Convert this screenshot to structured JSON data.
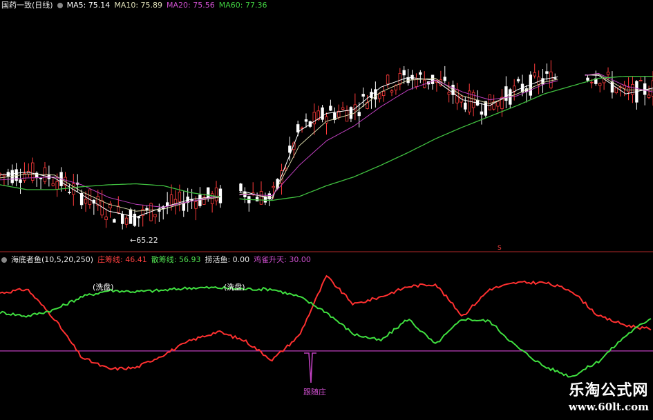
{
  "header": {
    "stock": "国药一致(日线)",
    "ma5": "MA5: 75.14",
    "ma10": "MA10: 75.89",
    "ma20": "MA20: 75.56",
    "ma60": "MA60: 77.36"
  },
  "indicator": {
    "name": "海底者鱼(10,5,20,250)",
    "zhuang": "庄筹线: 46.41",
    "san": "散筹线: 56.93",
    "laohuo": "捞活鱼: 0.00",
    "jique": "鸡雀升天: 30.00"
  },
  "annotations": {
    "low_price": "←65.22",
    "xipan1": "(洗盘)",
    "xipan2": "(洗盘)",
    "genzhuang": "跟随庄",
    "s_mark": "S"
  },
  "watermark": {
    "line1": "乐淘公式网",
    "line2": "www.60lt.com"
  },
  "colors": {
    "background": "#000000",
    "up": "#ff3b3b",
    "down": "#ffffff",
    "ma5": "#ffffff",
    "ma10": "#d8d8a8",
    "ma20": "#c040c0",
    "ma60": "#40c040",
    "zhuang": "#ff3030",
    "san": "#40e040",
    "level_line": "#c040c0"
  },
  "chart_data": [
    {
      "type": "line",
      "title": "国药一致(日线)",
      "description": "candlestick price chart with moving averages",
      "x": [
        0,
        5,
        10,
        15,
        20,
        25,
        30,
        35,
        40,
        45,
        50,
        55,
        60,
        65,
        70,
        75,
        80,
        85,
        90,
        95,
        100,
        105,
        110,
        115,
        120
      ],
      "series": [
        {
          "name": "MA5",
          "values": [
            70.5,
            70.8,
            70.2,
            68.5,
            66.8,
            66.2,
            67.2,
            68.0,
            68.3,
            68.8,
            68.0,
            75.0,
            76.8,
            77.2,
            79.5,
            80.5,
            80.2,
            78.2,
            77.6,
            79.2,
            80.3,
            80.8,
            80.7,
            78.8,
            79.4
          ]
        },
        {
          "name": "MA10",
          "values": [
            70.2,
            70.6,
            70.5,
            68.8,
            67.5,
            66.8,
            67.0,
            67.8,
            68.2,
            68.6,
            68.2,
            73.5,
            76.0,
            76.8,
            79.0,
            80.2,
            80.4,
            78.6,
            77.8,
            78.8,
            80.0,
            80.6,
            80.8,
            79.2,
            79.2
          ]
        },
        {
          "name": "MA20",
          "values": [
            70.0,
            70.2,
            70.3,
            69.5,
            68.2,
            67.5,
            67.2,
            67.8,
            68.3,
            68.5,
            68.4,
            71.5,
            74.0,
            75.5,
            77.5,
            79.2,
            80.2,
            79.0,
            78.2,
            78.6,
            79.8,
            80.5,
            80.9,
            79.6,
            79.0
          ]
        },
        {
          "name": "MA60",
          "values": [
            69.5,
            69.0,
            69.0,
            69.3,
            69.5,
            69.6,
            69.4,
            68.7,
            68.3,
            68.0,
            67.9,
            68.3,
            69.4,
            70.3,
            71.5,
            72.8,
            74.2,
            75.4,
            76.5,
            77.6,
            78.8,
            79.6,
            80.4,
            80.6,
            80.6
          ]
        }
      ],
      "annotations": [
        "←65.22"
      ]
    },
    {
      "type": "line",
      "title": "海底者鱼(10,5,20,250)",
      "x": [
        0,
        5,
        10,
        15,
        20,
        25,
        30,
        35,
        40,
        45,
        50,
        55,
        60,
        65,
        70,
        75,
        80,
        85,
        90,
        95,
        100,
        105,
        110,
        115,
        120
      ],
      "series": [
        {
          "name": "庄筹线",
          "values": [
            75,
            78,
            55,
            25,
            16,
            17,
            27,
            38,
            45,
            38,
            23,
            42,
            88,
            66,
            72,
            80,
            82,
            57,
            78,
            83,
            83,
            77,
            57,
            50,
            46.41
          ]
        },
        {
          "name": "散筹线",
          "values": [
            60,
            57,
            62,
            72,
            77,
            76,
            77,
            79,
            79,
            78,
            78,
            72,
            60,
            43,
            38,
            55,
            35,
            55,
            53,
            33,
            18,
            10,
            22,
            42,
            56.93
          ]
        }
      ],
      "reference_line": 30.0,
      "markers": [
        "(洗盘)",
        "(洗盘)",
        "跟随庄",
        "S"
      ]
    }
  ]
}
